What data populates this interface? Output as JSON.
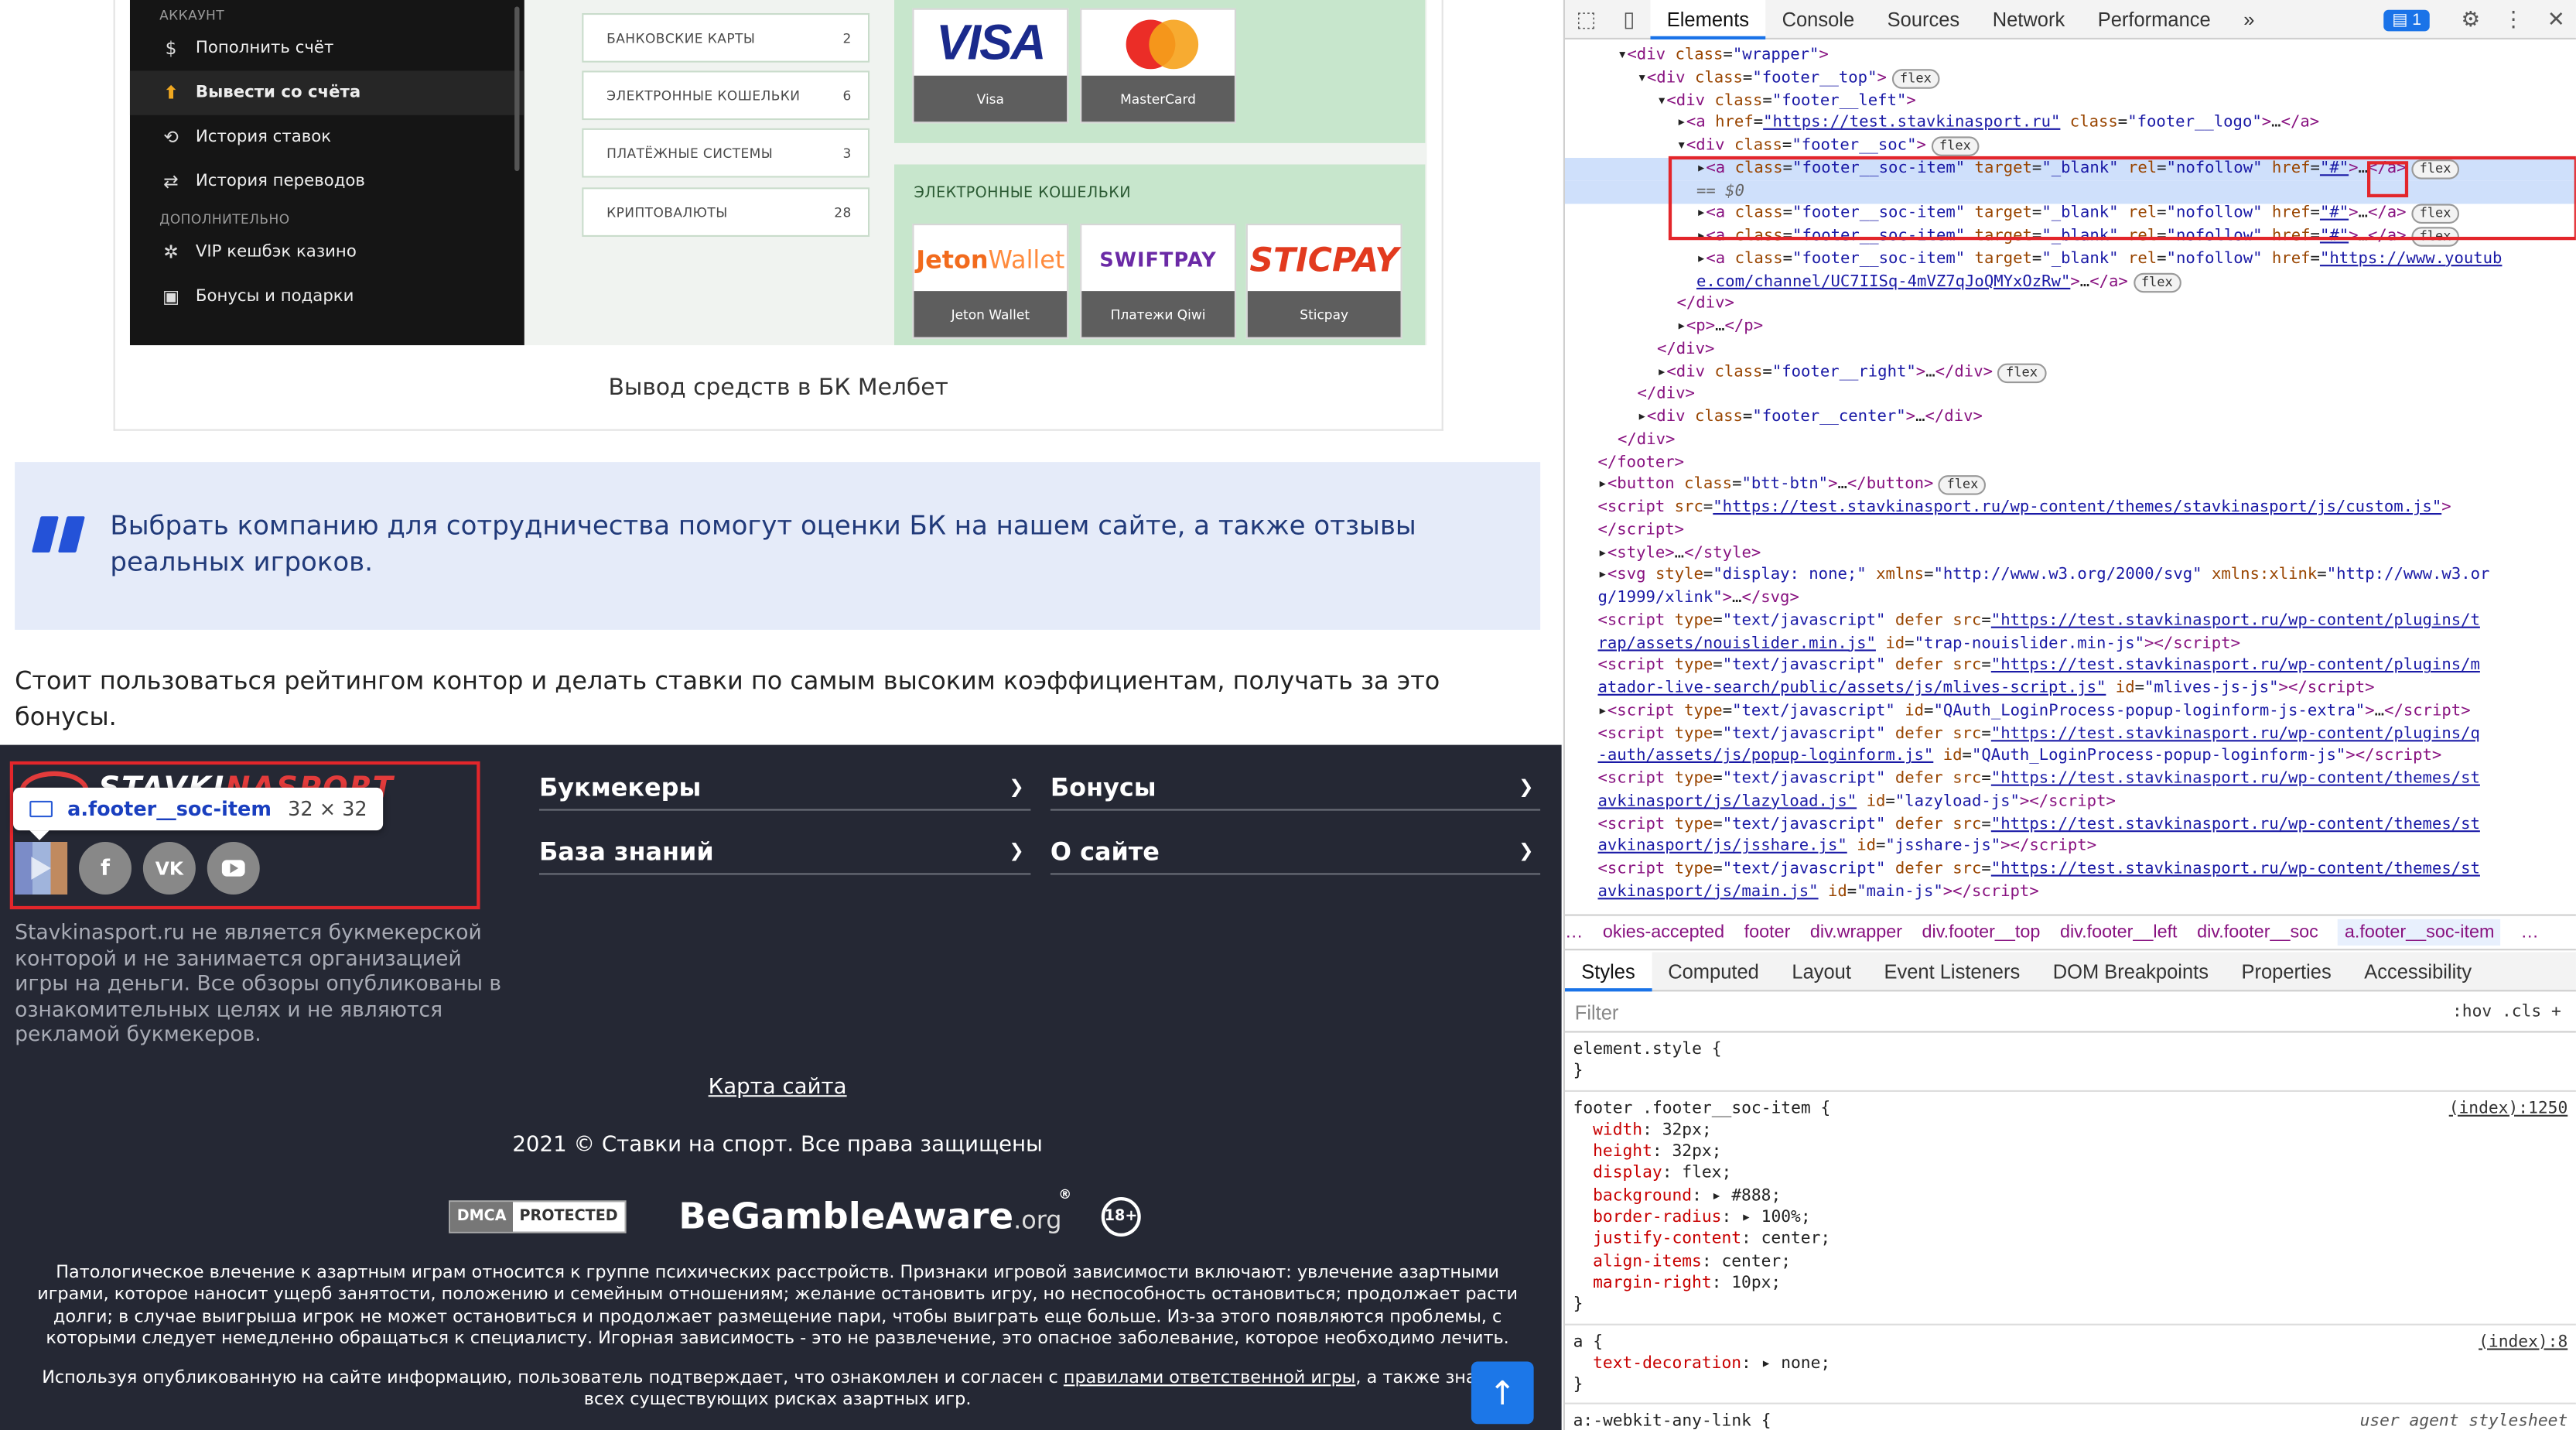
{
  "shot": {
    "sidebar": {
      "head1": "АККАУНТ",
      "items1": [
        {
          "icon": "$",
          "label": "Пополнить счёт"
        },
        {
          "icon": "⬆",
          "label": "Вывести со счёта"
        },
        {
          "icon": "⟲",
          "label": "История ставок"
        },
        {
          "icon": "⇄",
          "label": "История переводов"
        }
      ],
      "head2": "ДОПОЛНИТЕЛЬНО",
      "items2": [
        {
          "icon": "✲",
          "label": "VIP кешбэк казино"
        },
        {
          "icon": "▣",
          "label": "Бонусы и подарки"
        }
      ]
    },
    "categories": [
      {
        "label": "БАНКОВСКИЕ КАРТЫ",
        "count": "2"
      },
      {
        "label": "ЭЛЕКТРОННЫЕ КОШЕЛЬКИ",
        "count": "6"
      },
      {
        "label": "ПЛАТЁЖНЫЕ СИСТЕМЫ",
        "count": "3"
      },
      {
        "label": "КРИПТОВАЛЮТЫ",
        "count": "28"
      }
    ],
    "cards": {
      "visa_logo": "VISA",
      "visa": "Visa",
      "mc": "MasterCard"
    },
    "wallets": {
      "title": "ЭЛЕКТРОННЫЕ КОШЕЛЬКИ",
      "jeton_logo": "Jeton",
      "jeton_logo2": "Wallet",
      "jeton": "Jeton Wallet",
      "swift_logo": "SWIFTPAY",
      "swift": "Платежи Qiwi",
      "sticpay_logo": "STICPAY",
      "sticpay": "Sticpay"
    }
  },
  "caption": "Вывод средств в БК Мелбет",
  "quote": "Выбрать компанию для сотрудничества помогут оценки БК на нашем сайте, а также отзывы реальных игроков.",
  "para": "Стоит пользоваться рейтингом контор и делать ставки по самым высоким коэффициентам, получать за это бонусы.",
  "footer": {
    "logo_a": "STAVKI",
    "logo_b": "NASPORT",
    "tip_name": "a.footer__soc-item",
    "tip_size": "32 × 32",
    "vk": "VK",
    "fb": "f",
    "about": "Stavkinasport.ru не является букмекерской конторой и не занимается организацией игры на деньги. Все обзоры опубликованы в ознакомительных целях и не являются рекламой букмекеров.",
    "menus": [
      "Букмекеры",
      "Бонусы",
      "База знаний",
      "О сайте"
    ],
    "sitemap": "Карта сайта",
    "copyright": "2021 © Ставки на спорт. Все права защищены",
    "dmca1": "DMCA",
    "dmca2": "PROTECTED",
    "bga_main": "BeGambleAware",
    "bga_org": ".org",
    "bga_reg": "®",
    "age": "18+",
    "warning": "Патологическое влечение к азартным играм относится к группе психических расстройств. Признаки игровой зависимости включают: увлечение азартными играми, которое наносит ущерб занятости, положению и семейным отношениям; желание остановить игру, но неспособность остановиться; продолжает расти долги; в случае выигрыша игрок не может остановиться и продолжает размещение пари, чтобы выиграть еще больше. Из-за этого появляются проблемы, с которыми следует немедленно обращаться к специалисту. Игорная зависимость - это не развлечение, это опасное заболевание, которое необходимо лечить.",
    "agree_a": "Используя опубликованную на сайте информацию, пользователь подтверждает, что ознакомлен и согласен с ",
    "agree_link": "правилами ответственной игры",
    "agree_b": ", а также знает о всех существующих рисках азартных игр."
  },
  "devtools": {
    "tabs": [
      "Elements",
      "Console",
      "Sources",
      "Network",
      "Performance",
      "»"
    ],
    "issues": "1",
    "crumbs": [
      "…",
      "okies-accepted",
      "footer",
      "div.wrapper",
      "div.footer__top",
      "div.footer__left",
      "div.footer__soc",
      "a.footer__soc-item",
      "…"
    ],
    "subtabs": [
      "Styles",
      "Computed",
      "Layout",
      "Event Listeners",
      "DOM Breakpoints",
      "Properties",
      "Accessibility"
    ],
    "filter": "Filter",
    "filter_right": ":hov  .cls  +",
    "css": {
      "element_style": "element.style {",
      "close": "}",
      "rule1_sel": "footer .footer__soc-item {",
      "rule1_src": "(index):1250",
      "rule1": [
        "width: 32px;",
        "height: 32px;",
        "display: flex;",
        "background: ▸ #888;",
        "border-radius: ▸ 100%;",
        "justify-content: center;",
        "align-items: center;",
        "margin-right: 10px;"
      ],
      "rule2_sel": "a {",
      "rule2_src": "(index):8",
      "rule2": [
        "text-decoration: ▸ none;"
      ],
      "rule3_sel": "a:-webkit-any-link {",
      "rule3_src": "user agent stylesheet"
    }
  }
}
